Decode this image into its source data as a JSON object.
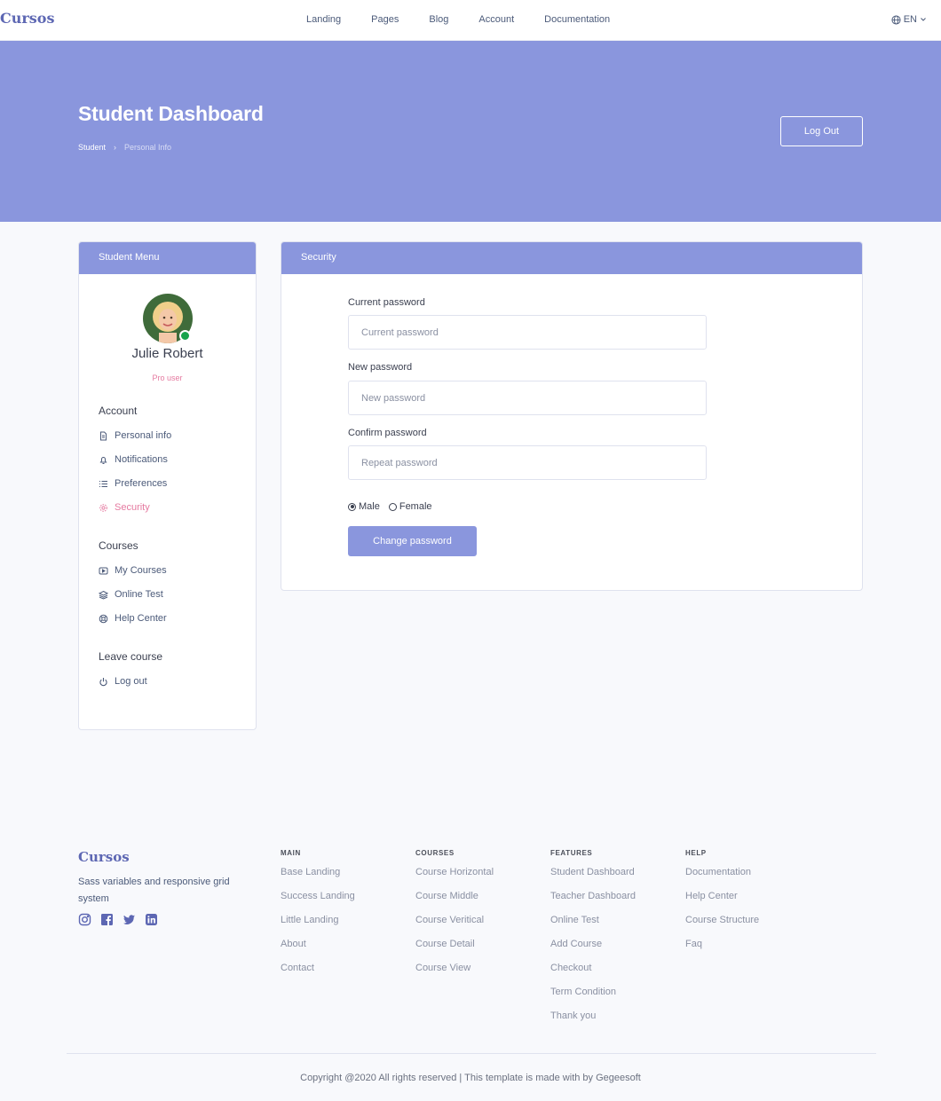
{
  "nav": {
    "brand": "Cursos",
    "links": [
      "Landing",
      "Pages",
      "Blog",
      "Account",
      "Documentation"
    ],
    "language": "EN"
  },
  "hero": {
    "title": "Student Dashboard",
    "breadcrumb": [
      "Student",
      "Personal Info"
    ],
    "logout_label": "Log Out"
  },
  "menu": {
    "header": "Student Menu",
    "user_name": "Julie Robert",
    "user_role": "Pro user",
    "groups": [
      {
        "title": "Account",
        "items": [
          "Personal info",
          "Notifications",
          "Preferences",
          "Security"
        ]
      },
      {
        "title": "Courses",
        "items": [
          "My Courses",
          "Online Test",
          "Help Center"
        ]
      },
      {
        "title": "Leave course",
        "items": [
          "Log out"
        ]
      }
    ]
  },
  "security": {
    "header": "Security",
    "current_label": "Current password",
    "current_placeholder": "Current password",
    "new_label": "New password",
    "new_placeholder": "New password",
    "confirm_label": "Confirm password",
    "confirm_placeholder": "Repeat password",
    "gender_options": [
      "Male",
      "Female"
    ],
    "selected_gender": "Male",
    "submit_label": "Change password"
  },
  "footer": {
    "brand": "Cursos",
    "description": "Sass variables and responsive grid system",
    "columns": [
      {
        "title": "MAIN",
        "links": [
          "Base Landing",
          "Success Landing",
          "Little Landing",
          "About",
          "Contact"
        ]
      },
      {
        "title": "COURSES",
        "links": [
          "Course Horizontal",
          "Course Middle",
          "Course Veritical",
          "Course Detail",
          "Course View"
        ]
      },
      {
        "title": "FEATURES",
        "links": [
          "Student Dashboard",
          "Teacher Dashboard",
          "Online Test",
          "Add Course",
          "Checkout",
          "Term Condition",
          "Thank you"
        ]
      },
      {
        "title": "HELP",
        "links": [
          "Documentation",
          "Help Center",
          "Course Structure",
          "Faq"
        ]
      }
    ],
    "copyright": "Copyright @2020 All rights reserved | This template is made with by Gegeesoft"
  },
  "colors": {
    "primary": "#8a96dd",
    "brand": "#5d67b3",
    "active": "#e57aa0",
    "online": "#16a34a"
  }
}
